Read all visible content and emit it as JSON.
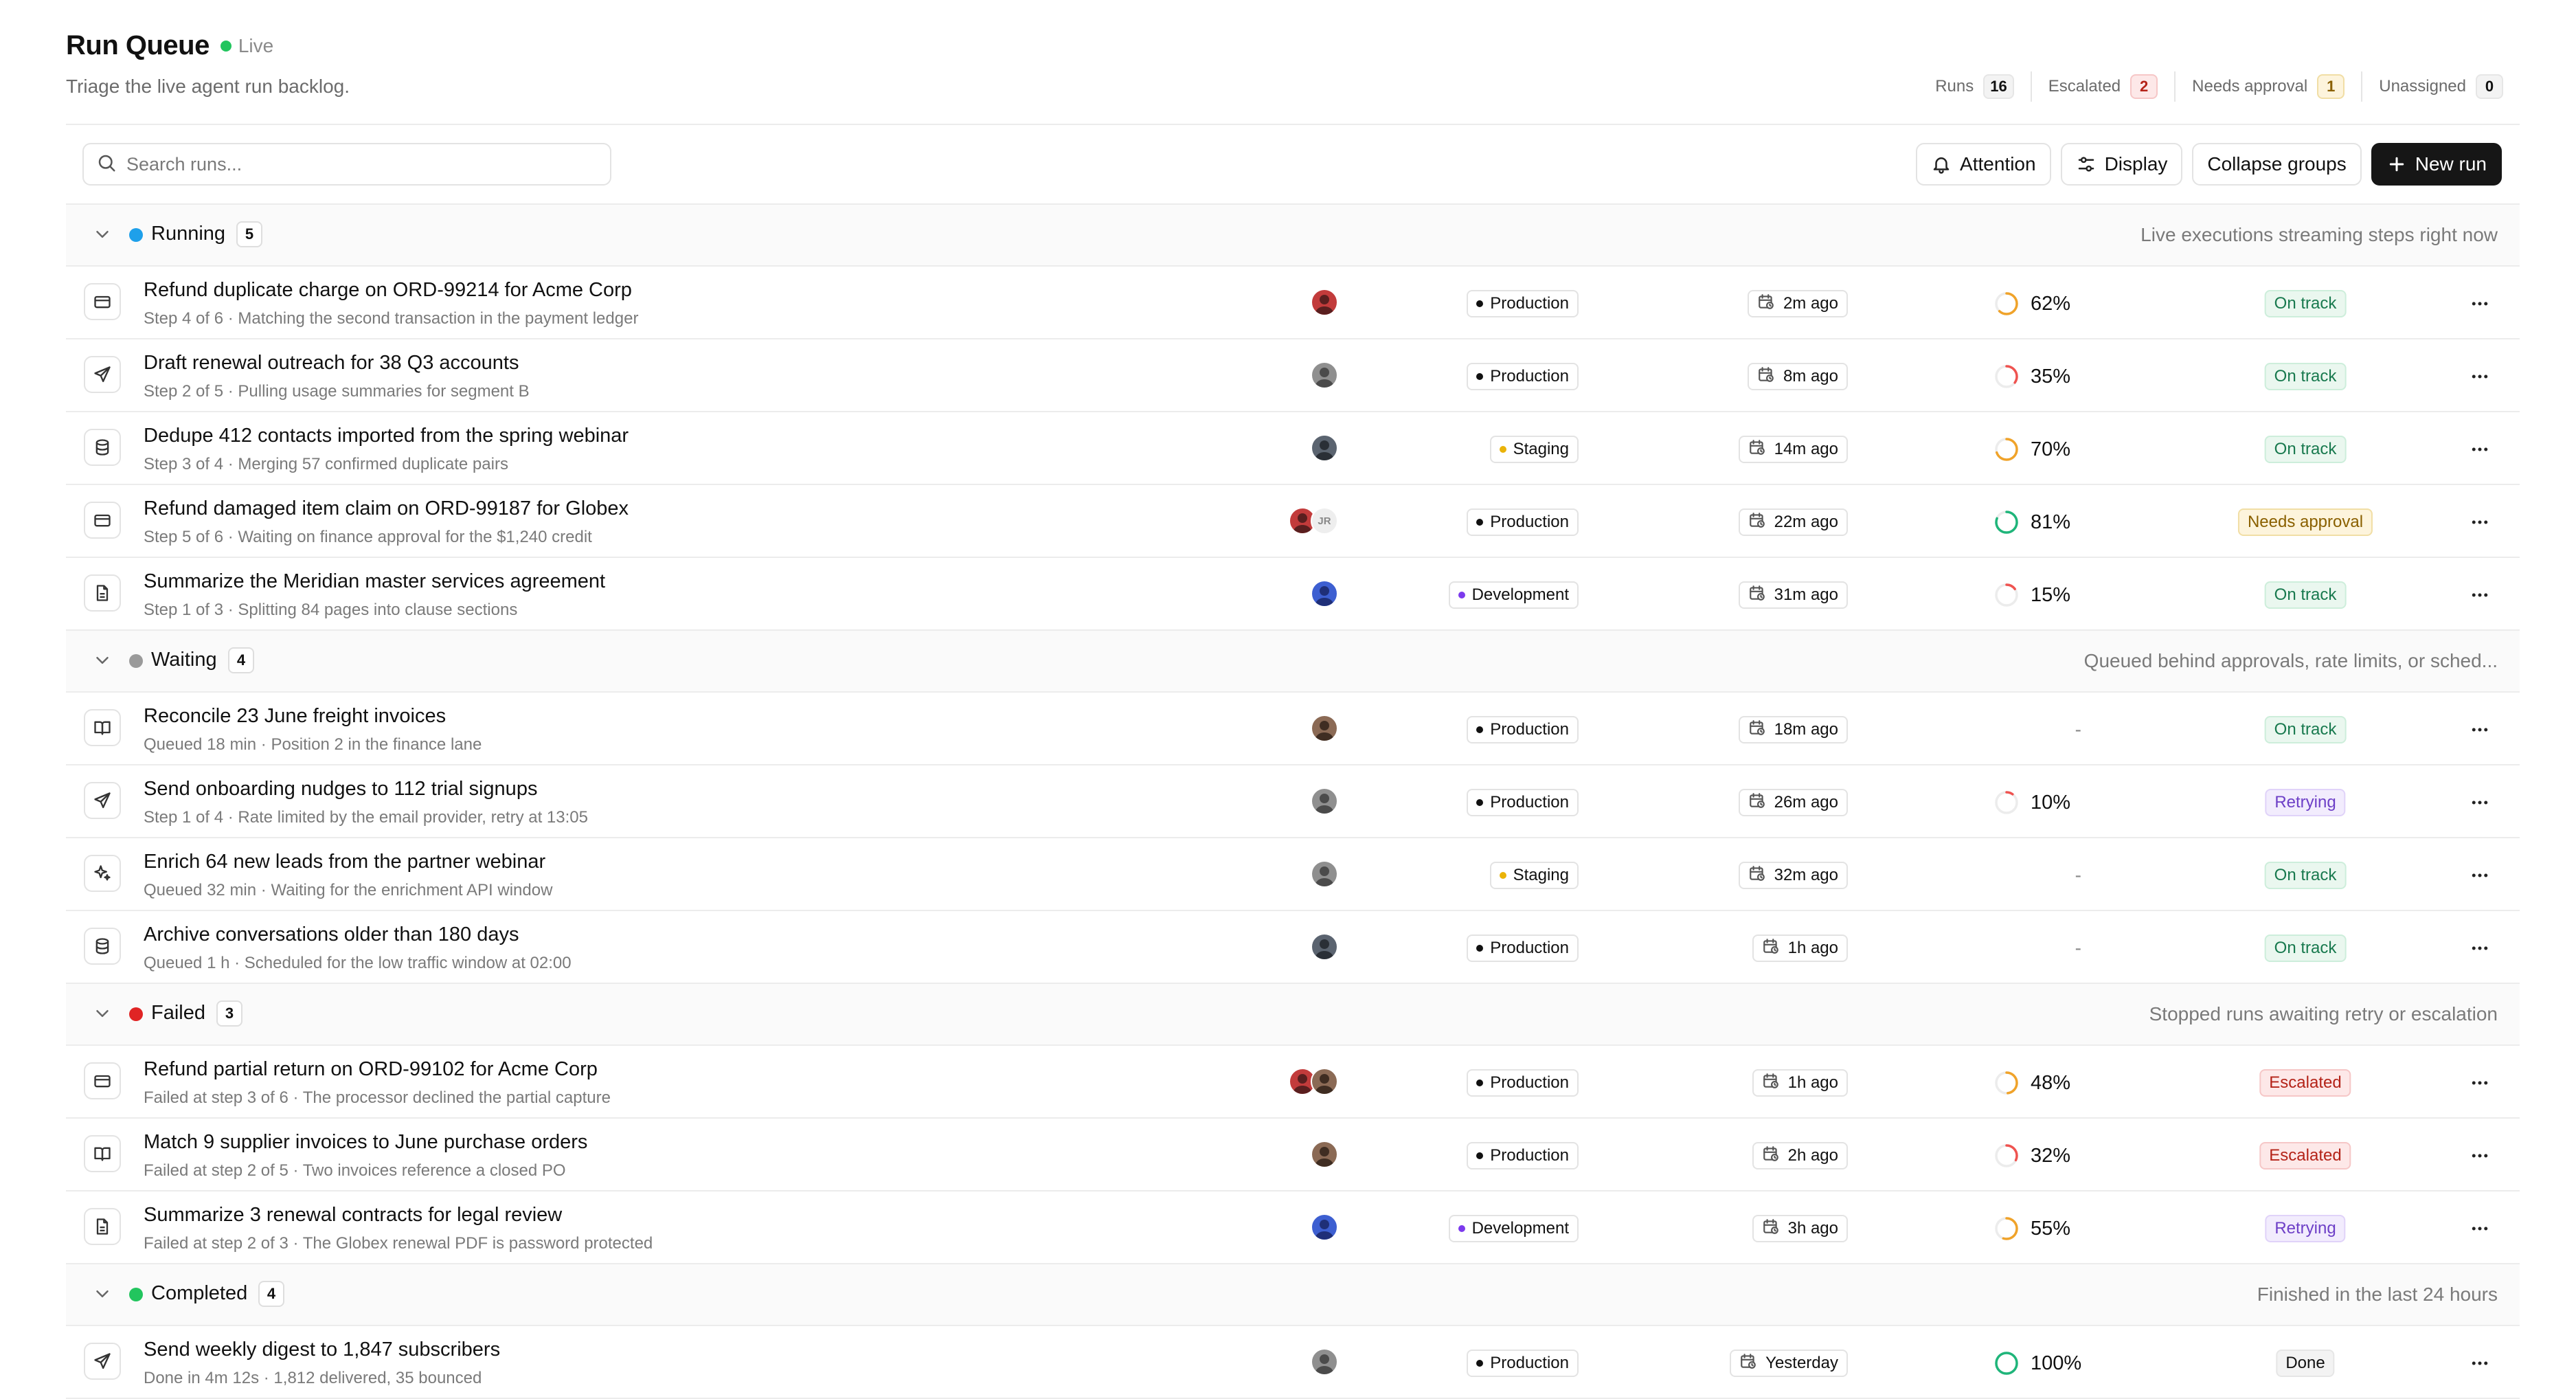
{
  "header": {
    "title": "Run Queue",
    "live_label": "Live",
    "subtitle": "Triage the live agent run backlog.",
    "stats": [
      {
        "label": "Runs",
        "count": "16",
        "tone": "neutral"
      },
      {
        "label": "Escalated",
        "count": "2",
        "tone": "red"
      },
      {
        "label": "Needs approval",
        "count": "1",
        "tone": "amber"
      },
      {
        "label": "Unassigned",
        "count": "0",
        "tone": "neutral"
      }
    ]
  },
  "toolbar": {
    "search_placeholder": "Search runs...",
    "attention_label": "Attention",
    "display_label": "Display",
    "collapse_label": "Collapse groups",
    "new_run_label": "New run"
  },
  "colors": {
    "running": "#1ea0ea",
    "waiting": "#9a9a9a",
    "failed": "#e02424",
    "completed": "#22c55e",
    "production": "#111111",
    "staging": "#eab308",
    "development": "#7c3aed",
    "progress_amber": "#f0a32a",
    "progress_red": "#ef5350",
    "progress_green": "#1fb57a"
  },
  "groups": [
    {
      "key": "running",
      "name": "Running",
      "count": "5",
      "description": "Live executions streaming steps right now",
      "rows": [
        {
          "icon": "card",
          "title": "Refund duplicate charge on ORD-99214 for Acme Corp",
          "subtitle": "Step 4 of 6 · Matching the second transaction in the payment ledger",
          "avatars": [
            "red"
          ],
          "env": "Production",
          "time": "2m ago",
          "progress": 62,
          "progress_label": "62%",
          "status": "On track",
          "status_tone": "ontrack"
        },
        {
          "icon": "send",
          "title": "Draft renewal outreach for 38 Q3 accounts",
          "subtitle": "Step 2 of 5 · Pulling usage summaries for segment B",
          "avatars": [
            "gray"
          ],
          "env": "Production",
          "time": "8m ago",
          "progress": 35,
          "progress_label": "35%",
          "status": "On track",
          "status_tone": "ontrack"
        },
        {
          "icon": "database",
          "title": "Dedupe 412 contacts imported from the spring webinar",
          "subtitle": "Step 3 of 4 · Merging 57 confirmed duplicate pairs",
          "avatars": [
            "slate"
          ],
          "env": "Staging",
          "time": "14m ago",
          "progress": 70,
          "progress_label": "70%",
          "status": "On track",
          "status_tone": "ontrack"
        },
        {
          "icon": "card",
          "title": "Refund damaged item claim on ORD-99187 for Globex",
          "subtitle": "Step 5 of 6 · Waiting on finance approval for the $1,240 credit",
          "avatars": [
            "red",
            "JR"
          ],
          "env": "Production",
          "time": "22m ago",
          "progress": 81,
          "progress_label": "81%",
          "status": "Needs approval",
          "status_tone": "approval"
        },
        {
          "icon": "document",
          "title": "Summarize the Meridian master services agreement",
          "subtitle": "Step 1 of 3 · Splitting 84 pages into clause sections",
          "avatars": [
            "blue"
          ],
          "env": "Development",
          "time": "31m ago",
          "progress": 15,
          "progress_label": "15%",
          "status": "On track",
          "status_tone": "ontrack"
        }
      ]
    },
    {
      "key": "waiting",
      "name": "Waiting",
      "count": "4",
      "description": "Queued behind approvals, rate limits, or sched...",
      "rows": [
        {
          "icon": "book",
          "title": "Reconcile 23 June freight invoices",
          "subtitle": "Queued 18 min · Position 2 in the finance lane",
          "avatars": [
            "brown"
          ],
          "env": "Production",
          "time": "18m ago",
          "progress": null,
          "progress_label": "-",
          "status": "On track",
          "status_tone": "ontrack"
        },
        {
          "icon": "send",
          "title": "Send onboarding nudges to 112 trial signups",
          "subtitle": "Step 1 of 4 · Rate limited by the email provider, retry at 13:05",
          "avatars": [
            "gray"
          ],
          "env": "Production",
          "time": "26m ago",
          "progress": 10,
          "progress_label": "10%",
          "status": "Retrying",
          "status_tone": "retrying"
        },
        {
          "icon": "sparkle",
          "title": "Enrich 64 new leads from the partner webinar",
          "subtitle": "Queued 32 min · Waiting for the enrichment API window",
          "avatars": [
            "gray"
          ],
          "env": "Staging",
          "time": "32m ago",
          "progress": null,
          "progress_label": "-",
          "status": "On track",
          "status_tone": "ontrack"
        },
        {
          "icon": "database",
          "title": "Archive conversations older than 180 days",
          "subtitle": "Queued 1 h · Scheduled for the low traffic window at 02:00",
          "avatars": [
            "slate"
          ],
          "env": "Production",
          "time": "1h ago",
          "progress": null,
          "progress_label": "-",
          "status": "On track",
          "status_tone": "ontrack"
        }
      ]
    },
    {
      "key": "failed",
      "name": "Failed",
      "count": "3",
      "description": "Stopped runs awaiting retry or escalation",
      "rows": [
        {
          "icon": "card",
          "title": "Refund partial return on ORD-99102 for Acme Corp",
          "subtitle": "Failed at step 3 of 6 · The processor declined the partial capture",
          "avatars": [
            "red",
            "brown"
          ],
          "env": "Production",
          "time": "1h ago",
          "progress": 48,
          "progress_label": "48%",
          "status": "Escalated",
          "status_tone": "escalated"
        },
        {
          "icon": "book",
          "title": "Match 9 supplier invoices to June purchase orders",
          "subtitle": "Failed at step 2 of 5 · Two invoices reference a closed PO",
          "avatars": [
            "brown"
          ],
          "env": "Production",
          "time": "2h ago",
          "progress": 32,
          "progress_label": "32%",
          "status": "Escalated",
          "status_tone": "escalated"
        },
        {
          "icon": "document",
          "title": "Summarize 3 renewal contracts for legal review",
          "subtitle": "Failed at step 2 of 3 · The Globex renewal PDF is password protected",
          "avatars": [
            "blue"
          ],
          "env": "Development",
          "time": "3h ago",
          "progress": 55,
          "progress_label": "55%",
          "status": "Retrying",
          "status_tone": "retrying"
        }
      ]
    },
    {
      "key": "completed",
      "name": "Completed",
      "count": "4",
      "description": "Finished in the last 24 hours",
      "rows": [
        {
          "icon": "send",
          "title": "Send weekly digest to 1,847 subscribers",
          "subtitle": "Done in 4m 12s · 1,812 delivered, 35 bounced",
          "avatars": [
            "gray"
          ],
          "env": "Production",
          "time": "Yesterday",
          "progress": 100,
          "progress_label": "100%",
          "status": "Done",
          "status_tone": "done"
        }
      ]
    }
  ]
}
